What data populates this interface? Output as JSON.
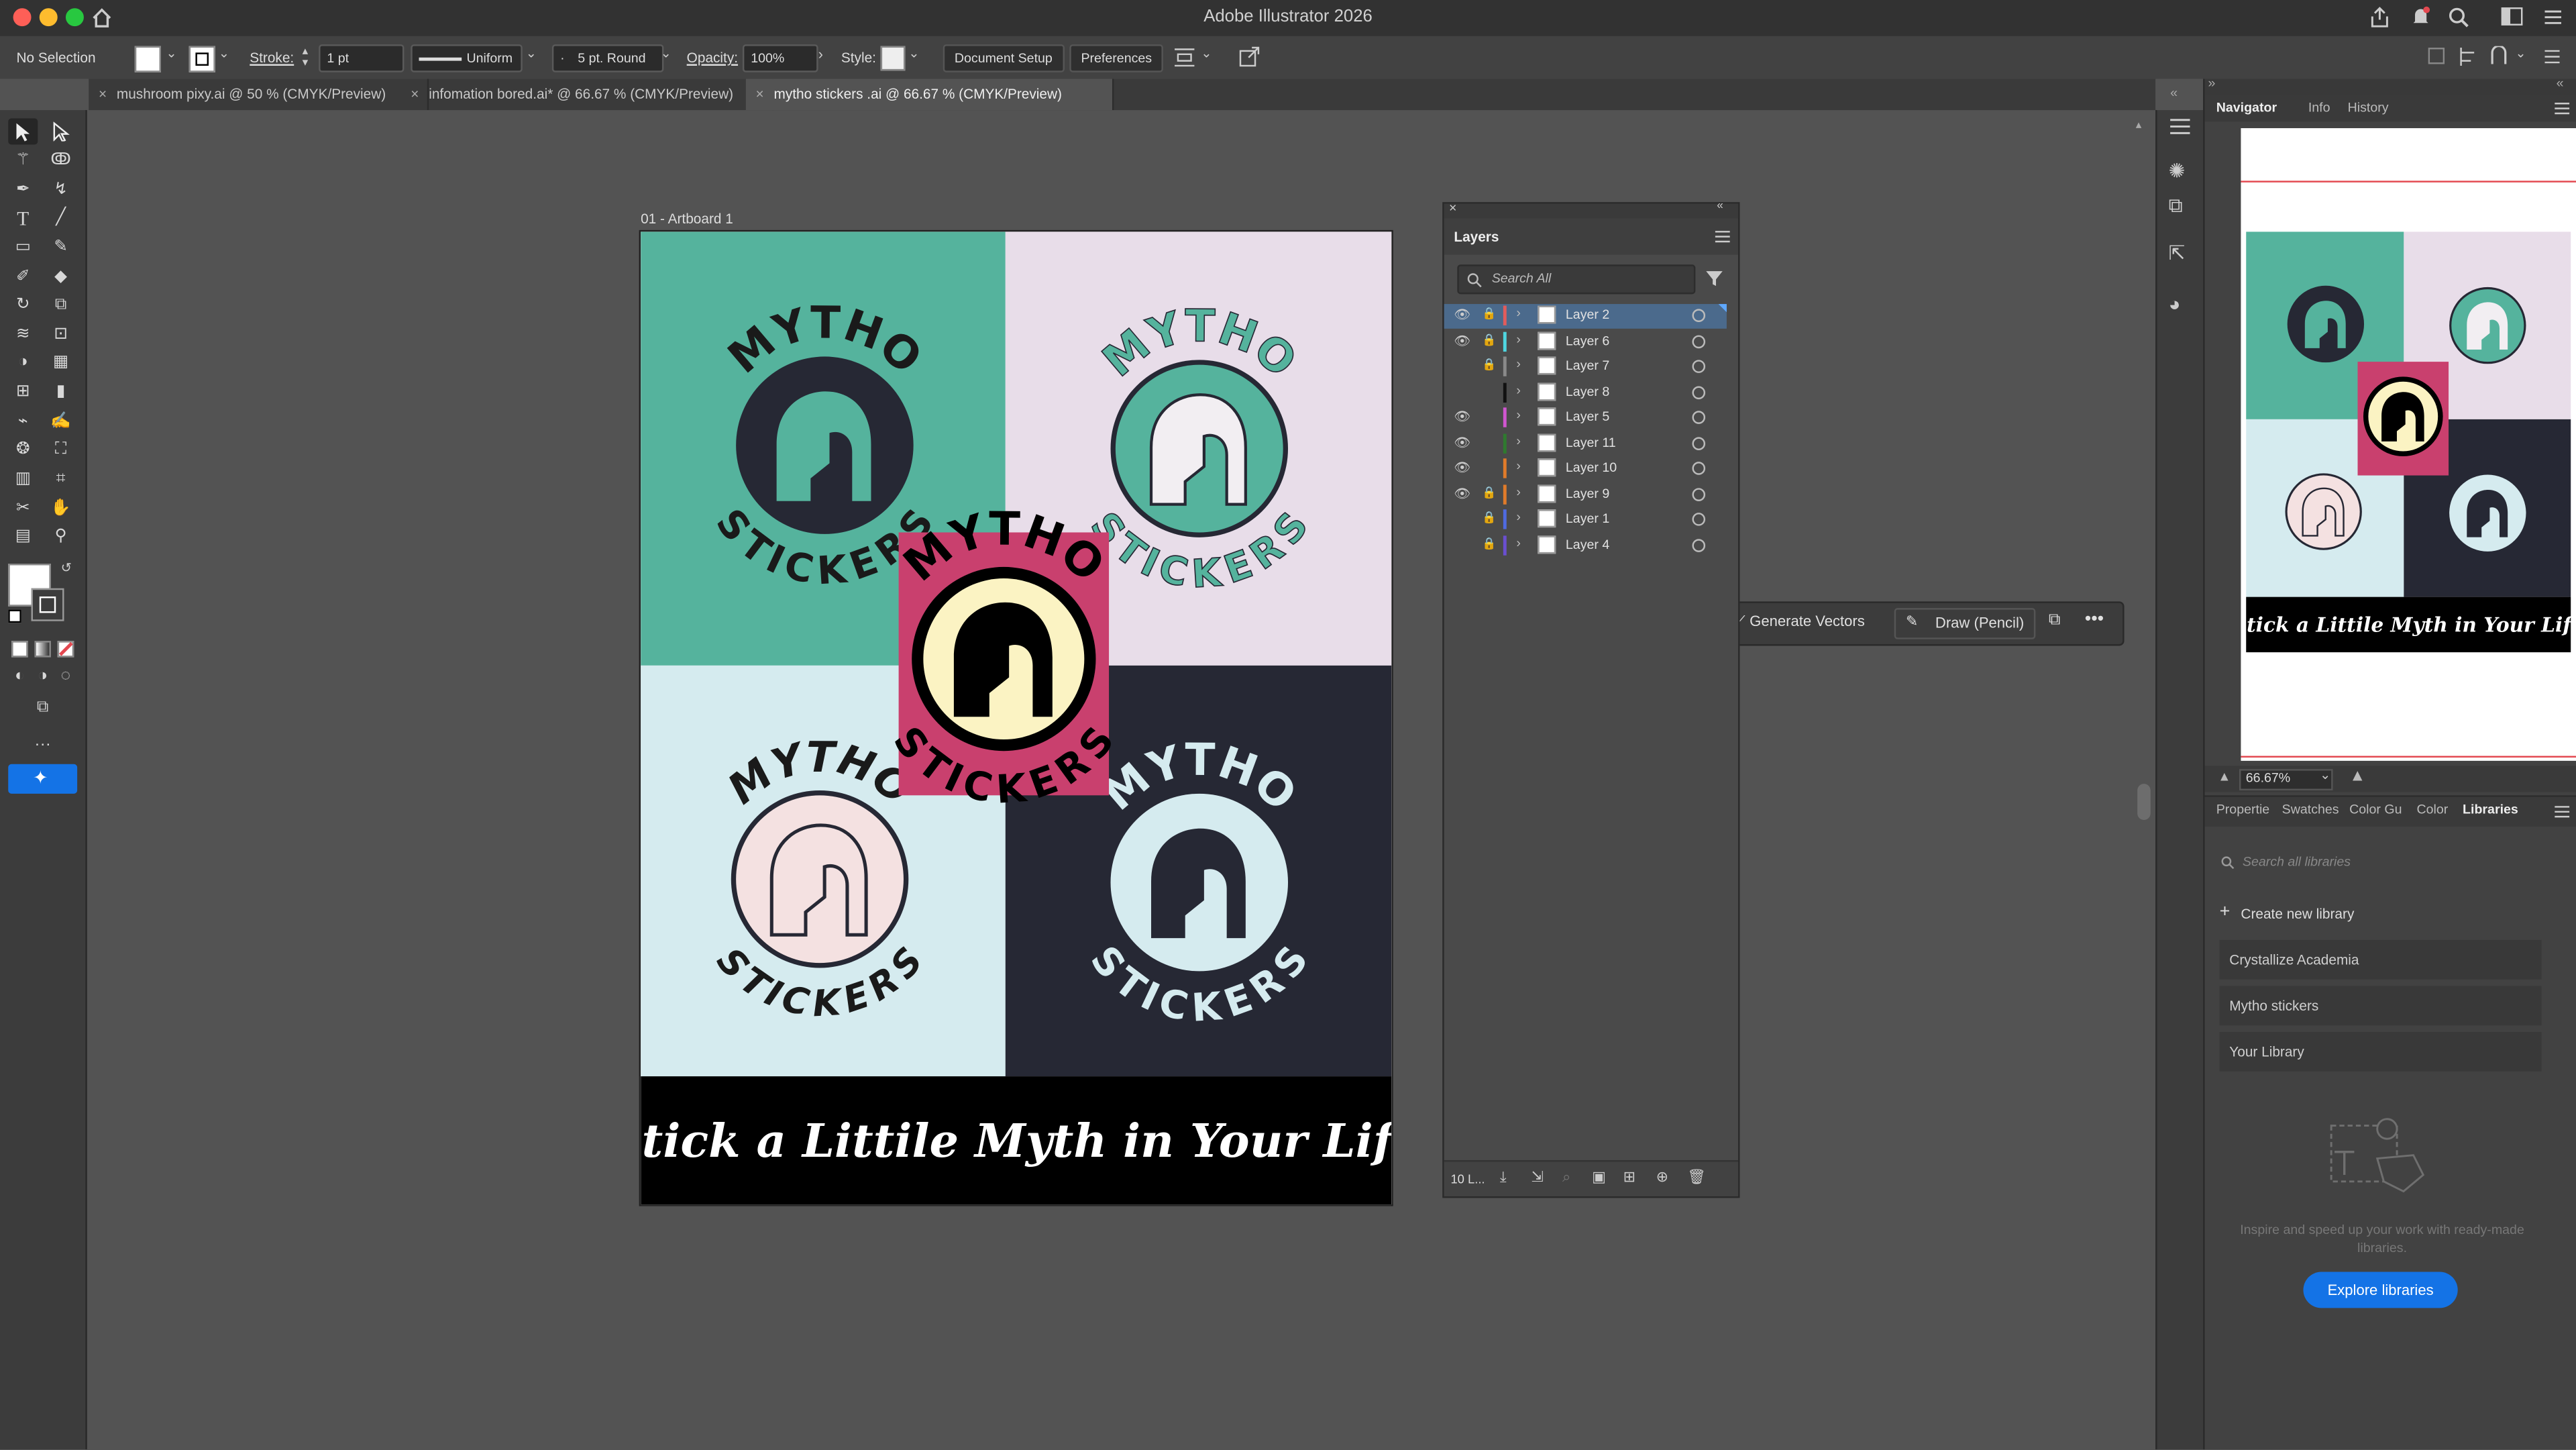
{
  "window": {
    "title": "Adobe Illustrator 2026"
  },
  "control_bar": {
    "selection": "No Selection",
    "stroke_label": "Stroke:",
    "stroke_value": "1 pt",
    "profile": "Uniform",
    "brush": "5 pt. Round",
    "opacity_label": "Opacity:",
    "opacity_value": "100%",
    "style_label": "Style:",
    "document_setup": "Document Setup",
    "preferences": "Preferences"
  },
  "tabs": [
    {
      "label": "mushroom pixy.ai @ 50 % (CMYK/Preview)"
    },
    {
      "label": "infomation bored.ai* @ 66.67 % (CMYK/Preview)"
    },
    {
      "label": "mytho stickers .ai @ 66.67 % (CMYK/Preview)"
    }
  ],
  "artboard": {
    "name": "01 - Artboard 1",
    "sticker_top": "MYTHO",
    "sticker_bottom": "STICKERS",
    "tagline": "Stick a Littile Myth in Your Life",
    "colors": {
      "teal": "#55b39d",
      "lilac": "#e8dde9",
      "ice": "#d5ebef",
      "navy": "#262834",
      "magenta": "#c9406e",
      "cream": "#fbf3c3",
      "pink": "#f4e1e1"
    }
  },
  "layers_panel": {
    "title": "Layers",
    "search_placeholder": "Search All",
    "footer": "10 L...",
    "layers": [
      {
        "name": "Layer 2",
        "color": "#e25c5c",
        "visible": true,
        "locked": true,
        "selected": true
      },
      {
        "name": "Layer 6",
        "color": "#4fd6e0",
        "visible": true,
        "locked": true
      },
      {
        "name": "Layer 7",
        "color": "#8a8a8a",
        "visible": false,
        "locked": true
      },
      {
        "name": "Layer 8",
        "color": "#111111",
        "visible": false,
        "locked": false
      },
      {
        "name": "Layer 5",
        "color": "#d056d0",
        "visible": true,
        "locked": false
      },
      {
        "name": "Layer 11",
        "color": "#2f7a2f",
        "visible": true,
        "locked": false
      },
      {
        "name": "Layer 10",
        "color": "#e07b2a",
        "visible": true,
        "locked": false
      },
      {
        "name": "Layer 9",
        "color": "#e07b2a",
        "visible": true,
        "locked": true
      },
      {
        "name": "Layer 1",
        "color": "#4f6ae0",
        "visible": false,
        "locked": true
      },
      {
        "name": "Layer 4",
        "color": "#6a4fd0",
        "visible": false,
        "locked": true
      }
    ]
  },
  "context_bar": {
    "generate": "Generate Vectors",
    "draw": "Draw (Pencil)"
  },
  "navigator": {
    "tabs": [
      "Navigator",
      "Info",
      "History"
    ],
    "zoom": "66.67%"
  },
  "libraries": {
    "tabs": [
      "Propertie",
      "Swatches",
      "Color Gu",
      "Color",
      "Libraries"
    ],
    "search_placeholder": "Search all libraries",
    "create": "Create new library",
    "items": [
      "Crystallize Academia",
      "Mytho stickers",
      "Your Library"
    ],
    "hint": "Inspire and speed up your work with ready-made libraries.",
    "explore": "Explore libraries"
  }
}
